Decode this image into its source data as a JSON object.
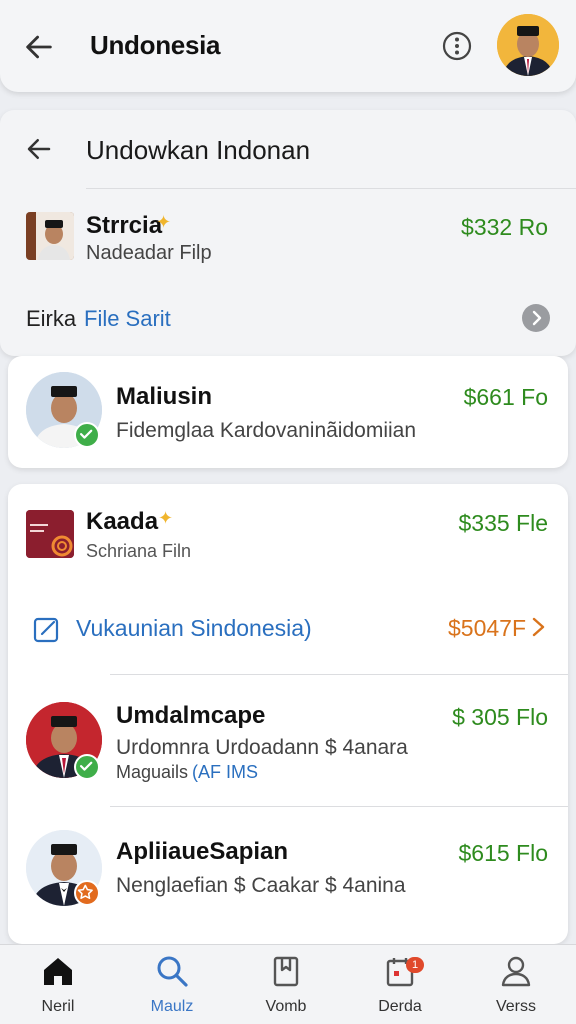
{
  "appbar": {
    "title": "Undonesia"
  },
  "panel": {
    "title": "Undowkan Indonan",
    "item": {
      "name": "Strrcia",
      "subtitle": "Nadeadar Filp",
      "price": "$332 Ro"
    },
    "footer": {
      "prefix": "Eirka",
      "link": "File Sarit"
    }
  },
  "card1": {
    "name": "Maliusin",
    "subtitle": "Fidemglaa Kardovaninãidomiian",
    "price": "$661 Fo"
  },
  "card2": {
    "item1": {
      "name": "Kaada",
      "subtitle": "Schriana Filn",
      "price": "$335 Fle"
    },
    "link_row": {
      "label": "Vukaunian Sindonesia)",
      "price": "$5047F"
    },
    "item2": {
      "name": "Umdalmcape",
      "line1": "Urdomnra Urdoadann $ 4anara",
      "line2_prefix": "Maguails",
      "line2_link": "(AF IMS",
      "price": "$ 305 Flo"
    },
    "item3": {
      "name": "ApliiaueSapian",
      "subtitle": "Nenglaefian $ Caakar $ 4anina",
      "price": "$615 Flo"
    }
  },
  "bottom_nav": [
    {
      "label": "Neril",
      "icon": "home-icon"
    },
    {
      "label": "Maulz",
      "icon": "search-icon"
    },
    {
      "label": "Vomb",
      "icon": "bookmark-icon"
    },
    {
      "label": "Derda",
      "icon": "calendar-icon",
      "badge": "1"
    },
    {
      "label": "Verss",
      "icon": "person-icon"
    }
  ],
  "colors": {
    "price_green": "#2e8b1e",
    "price_orange": "#d9731b",
    "link_blue": "#2a6fbf",
    "verified_green": "#3fae49",
    "badge_orange": "#e26b1e"
  }
}
